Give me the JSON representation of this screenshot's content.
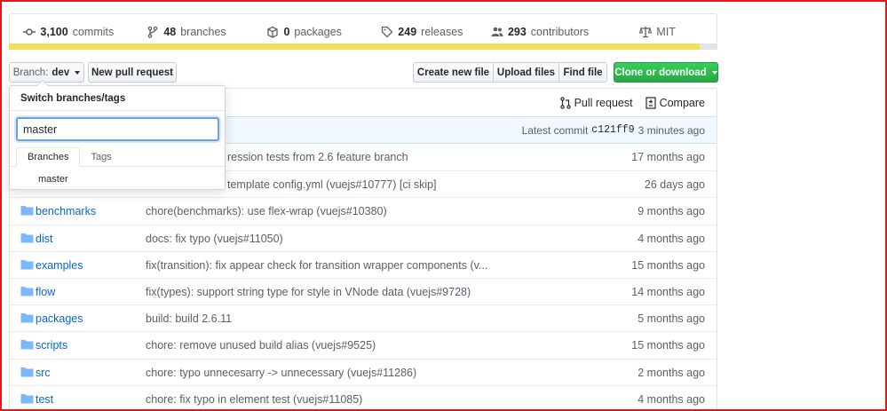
{
  "summary": {
    "commits": {
      "count": "3,100",
      "label": "commits"
    },
    "branches": {
      "count": "48",
      "label": "branches"
    },
    "packages": {
      "count": "0",
      "label": "packages"
    },
    "releases": {
      "count": "249",
      "label": "releases"
    },
    "contributors": {
      "count": "293",
      "label": "contributors"
    },
    "license": "MIT"
  },
  "language_bar": {
    "primary_color": "#f1e05a",
    "rest_color": "#e1e4e8"
  },
  "toolbar": {
    "branch_prefix": "Branch:",
    "branch_name": "dev",
    "new_pr": "New pull request",
    "create_file": "Create new file",
    "upload_files": "Upload files",
    "find_file": "Find file",
    "clone": "Clone or download"
  },
  "file_header": {
    "pull_request": "Pull request",
    "compare": "Compare"
  },
  "latest_commit": {
    "label": "Latest commit",
    "sha": "c121ff9",
    "age": "3 minutes ago"
  },
  "dropdown": {
    "title": "Switch branches/tags",
    "input_value": "master",
    "tabs": [
      "Branches",
      "Tags"
    ],
    "items": [
      "master"
    ]
  },
  "files": [
    {
      "name": "",
      "message": "ression tests from 2.6 feature branch",
      "age": "17 months ago"
    },
    {
      "name": "",
      "message": "template config.yml (vuejs#10777) [ci skip]",
      "age": "26 days ago"
    },
    {
      "name": "benchmarks",
      "message": "chore(benchmarks): use flex-wrap (vuejs#10380)",
      "age": "9 months ago"
    },
    {
      "name": "dist",
      "message": "docs: fix typo (vuejs#11050)",
      "age": "4 months ago"
    },
    {
      "name": "examples",
      "message": "fix(transition): fix appear check for transition wrapper components (v...",
      "age": "15 months ago"
    },
    {
      "name": "flow",
      "message": "fix(types): support string type for style in VNode data (vuejs#9728)",
      "age": "14 months ago"
    },
    {
      "name": "packages",
      "message": "build: build 2.6.11",
      "age": "5 months ago"
    },
    {
      "name": "scripts",
      "message": "chore: remove unused build alias (vuejs#9525)",
      "age": "15 months ago"
    },
    {
      "name": "src",
      "message": "chore: typo unnecesarry -> unnecessary (vuejs#11286)",
      "age": "2 months ago"
    },
    {
      "name": "test",
      "message": "chore: fix typo in element test (vuejs#11085)",
      "age": "4 months ago"
    }
  ],
  "colors": {
    "folder": "#79b8ff",
    "link": "#0366d6",
    "clone_button": "#28a745",
    "highlight_frame": "#e8161b"
  }
}
